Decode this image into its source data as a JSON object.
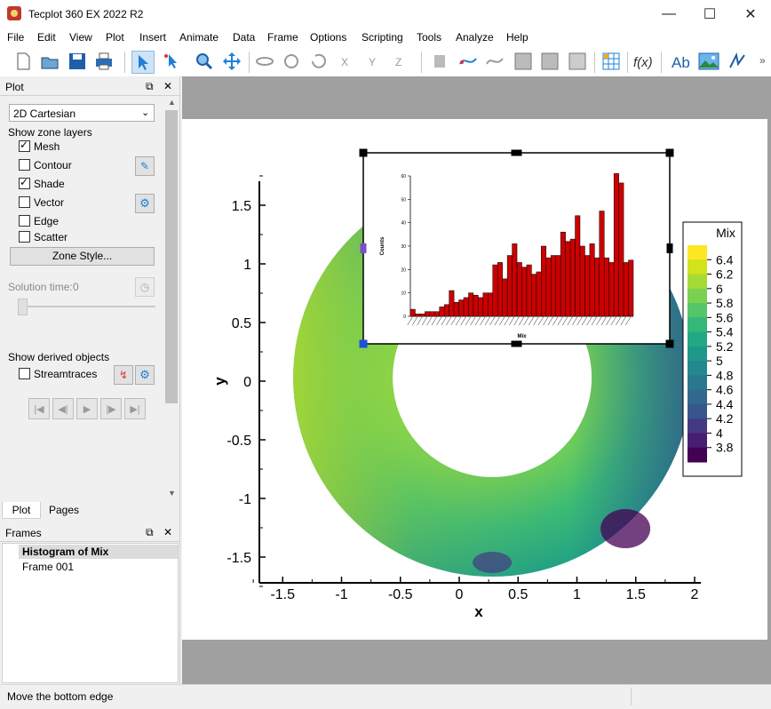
{
  "window": {
    "title": "Tecplot 360 EX 2022 R2",
    "minimize": "—",
    "maximize": "☐",
    "close": "✕"
  },
  "menu": [
    "File",
    "Edit",
    "View",
    "Plot",
    "Insert",
    "Animate",
    "Data",
    "Frame",
    "Options",
    "Scripting",
    "Tools",
    "Analyze",
    "Help"
  ],
  "toolbar": {
    "overflow": "»",
    "icons": [
      "new-layout-icon",
      "open-layout-icon",
      "save-icon",
      "print-icon",
      "selector-icon",
      "adjustor-icon",
      "zoom-icon",
      "translate-icon",
      "rotate-icon",
      "rollerball-icon",
      "spherical-rotate-icon",
      "x-rotate-icon",
      "y-rotate-icon",
      "z-rotate-icon",
      "probe-icon",
      "streamtrace-icon",
      "slice-icon",
      "contour-lines-icon",
      "iso-surface-icon",
      "zone-icon",
      "workspace-icon",
      "equation-icon",
      "text-icon",
      "image-icon",
      "line-icon"
    ]
  },
  "plot_panel": {
    "title": "Plot",
    "plot_type": "2D Cartesian",
    "show_zone_layers": "Show zone layers",
    "layers": [
      {
        "label": "Mesh",
        "checked": true
      },
      {
        "label": "Contour",
        "checked": false
      },
      {
        "label": "Shade",
        "checked": true
      },
      {
        "label": "Vector",
        "checked": false
      },
      {
        "label": "Edge",
        "checked": false
      },
      {
        "label": "Scatter",
        "checked": false
      }
    ],
    "zone_style": "Zone Style...",
    "solution_time_label": "Solution time:",
    "solution_time_value": "0",
    "show_derived": "Show derived objects",
    "streamtraces": "Streamtraces",
    "tabs": [
      "Plot",
      "Pages"
    ]
  },
  "frames_panel": {
    "title": "Frames",
    "items": [
      "Histogram of Mix",
      "Frame 001"
    ]
  },
  "status": "Move the bottom edge",
  "plot": {
    "xlabel": "x",
    "ylabel": "y",
    "xticks": [
      "-1.5",
      "-1",
      "-0.5",
      "0",
      "0.5",
      "1",
      "1.5",
      "2"
    ],
    "yticks": [
      "1.5",
      "1",
      "0.5",
      "0",
      "-0.5",
      "-1",
      "-1.5"
    ],
    "legend": {
      "title": "Mix",
      "levels": [
        "6.4",
        "6.2",
        "6",
        "5.8",
        "5.6",
        "5.4",
        "5.2",
        "5",
        "4.8",
        "4.6",
        "4.4",
        "4.2",
        "4",
        "3.8"
      ],
      "colors": [
        "#fde725",
        "#d2e21b",
        "#a5db36",
        "#7ad151",
        "#54c568",
        "#35b779",
        "#22a884",
        "#1f988b",
        "#23888e",
        "#2a788e",
        "#31688e",
        "#39568c",
        "#443983",
        "#481f70",
        "#440154"
      ]
    }
  },
  "histogram": {
    "xlabel": "Mix",
    "ylabel": "Counts",
    "yticks": [
      "0",
      "10",
      "20",
      "30",
      "40",
      "50",
      "60"
    ],
    "chart_data": {
      "type": "bar",
      "ylim": [
        0,
        60
      ],
      "color": "#cc0000",
      "ylabel": "Counts",
      "xlabel": "Mix",
      "values": [
        3,
        1,
        1,
        2,
        2,
        2,
        4,
        5,
        11,
        6,
        7,
        8,
        10,
        9,
        8,
        10,
        10,
        22,
        23,
        16,
        26,
        31,
        23,
        21,
        22,
        18,
        19,
        30,
        25,
        26,
        26,
        36,
        32,
        33,
        43,
        30,
        26,
        31,
        25,
        45,
        25,
        23,
        61,
        57,
        23,
        24
      ]
    }
  }
}
